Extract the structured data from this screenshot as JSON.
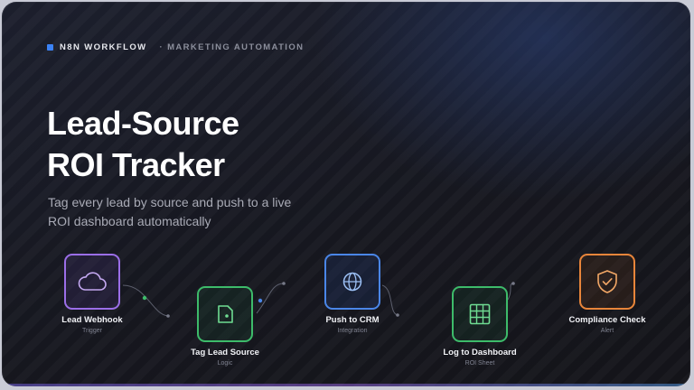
{
  "header": {
    "kicker": "N8N WORKFLOW",
    "category": "· MARKETING AUTOMATION"
  },
  "hero": {
    "title_line1": "Lead-Source",
    "title_line2": "ROI Tracker",
    "subtitle_line1": "Tag every lead by source and push to a live",
    "subtitle_line2": "ROI dashboard automatically"
  },
  "workflow": {
    "nodes": [
      {
        "name": "Lead Webhook",
        "type": "Trigger",
        "icon": "cloud-icon",
        "color": "#9b6ee8"
      },
      {
        "name": "Tag Lead Source",
        "type": "Logic",
        "icon": "tag-icon",
        "color": "#3dbb6a"
      },
      {
        "name": "Push to CRM",
        "type": "Integration",
        "icon": "globe-icon",
        "color": "#4a86e8"
      },
      {
        "name": "Log to Dashboard",
        "type": "ROI Sheet",
        "icon": "grid-icon",
        "color": "#3dbb6a"
      },
      {
        "name": "Compliance Check",
        "type": "Alert",
        "icon": "shield-check-icon",
        "color": "#e8853a"
      }
    ]
  },
  "colors": {
    "accent": "#3b82f6",
    "background": "#17181f",
    "text_primary": "#ffffff",
    "text_secondary": "#a9abb6"
  }
}
